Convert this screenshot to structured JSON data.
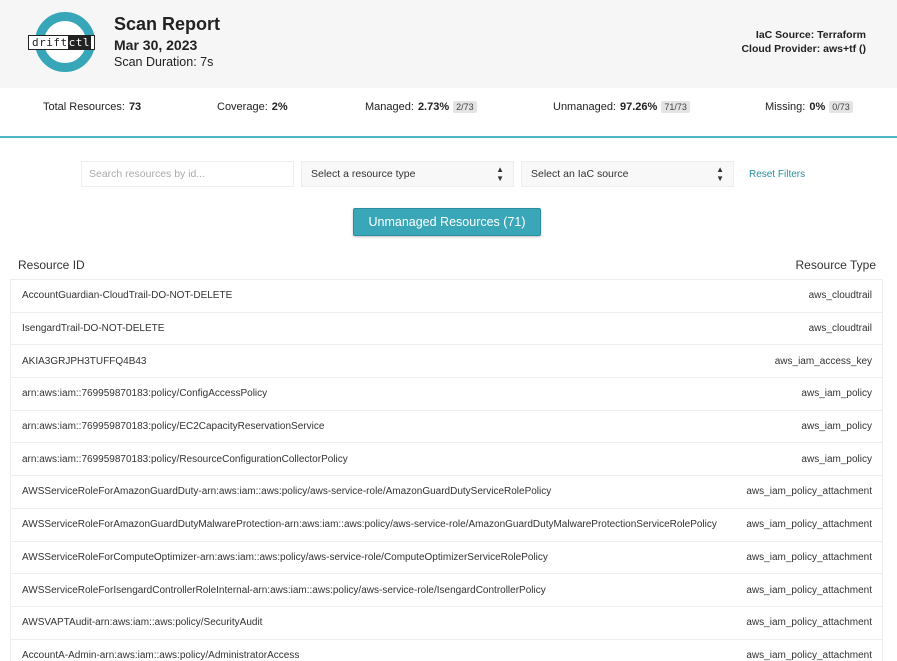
{
  "header": {
    "logo_text_a": "drift",
    "logo_text_b": "ctl",
    "title": "Scan Report",
    "date": "Mar 30, 2023",
    "duration": "Scan Duration: 7s",
    "iac_source": "IaC Source: Terraform",
    "cloud_provider": "Cloud Provider: aws+tf ()"
  },
  "stats": {
    "total_label": "Total Resources:",
    "total_value": "73",
    "coverage_label": "Coverage:",
    "coverage_value": "2%",
    "managed_label": "Managed:",
    "managed_value": "2.73%",
    "managed_chip": "2/73",
    "unmanaged_label": "Unmanaged:",
    "unmanaged_value": "97.26%",
    "unmanaged_chip": "71/73",
    "missing_label": "Missing:",
    "missing_value": "0%",
    "missing_chip": "0/73"
  },
  "filters": {
    "search_placeholder": "Search resources by id...",
    "type_select": "Select a resource type",
    "iac_select": "Select an IaC source",
    "reset_label": "Reset Filters"
  },
  "toggle_label": "Unmanaged Resources (71)",
  "table": {
    "col_id": "Resource ID",
    "col_type": "Resource Type",
    "rows": [
      {
        "id": "AccountGuardian-CloudTrail-DO-NOT-DELETE",
        "type": "aws_cloudtrail"
      },
      {
        "id": "IsengardTrail-DO-NOT-DELETE",
        "type": "aws_cloudtrail"
      },
      {
        "id": "AKIA3GRJPH3TUFFQ4B43",
        "type": "aws_iam_access_key"
      },
      {
        "id": "arn:aws:iam::769959870183:policy/ConfigAccessPolicy",
        "type": "aws_iam_policy"
      },
      {
        "id": "arn:aws:iam::769959870183:policy/EC2CapacityReservationService",
        "type": "aws_iam_policy"
      },
      {
        "id": "arn:aws:iam::769959870183:policy/ResourceConfigurationCollectorPolicy",
        "type": "aws_iam_policy"
      },
      {
        "id": "AWSServiceRoleForAmazonGuardDuty-arn:aws:iam::aws:policy/aws-service-role/AmazonGuardDutyServiceRolePolicy",
        "type": "aws_iam_policy_attachment"
      },
      {
        "id": "AWSServiceRoleForAmazonGuardDutyMalwareProtection-arn:aws:iam::aws:policy/aws-service-role/AmazonGuardDutyMalwareProtectionServiceRolePolicy",
        "type": "aws_iam_policy_attachment"
      },
      {
        "id": "AWSServiceRoleForComputeOptimizer-arn:aws:iam::aws:policy/aws-service-role/ComputeOptimizerServiceRolePolicy",
        "type": "aws_iam_policy_attachment"
      },
      {
        "id": "AWSServiceRoleForIsengardControllerRoleInternal-arn:aws:iam::aws:policy/aws-service-role/IsengardControllerPolicy",
        "type": "aws_iam_policy_attachment"
      },
      {
        "id": "AWSVAPTAudit-arn:aws:iam::aws:policy/SecurityAudit",
        "type": "aws_iam_policy_attachment"
      },
      {
        "id": "AccountA-Admin-arn:aws:iam::aws:policy/AdministratorAccess",
        "type": "aws_iam_policy_attachment"
      }
    ]
  },
  "colors": {
    "accent": "#3aa7b9",
    "header_bg": "#f6f6f6"
  }
}
